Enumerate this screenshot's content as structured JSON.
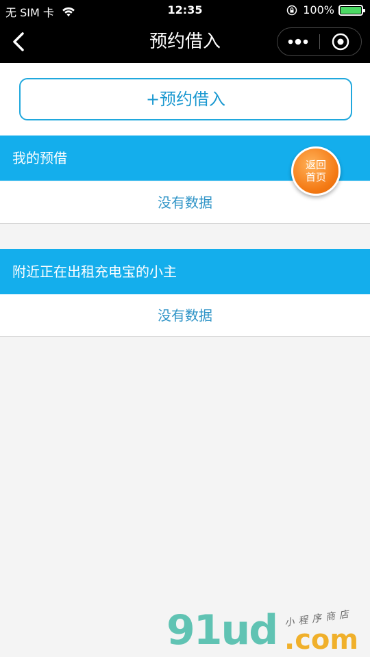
{
  "status_bar": {
    "carrier": "无 SIM 卡",
    "time": "12:35",
    "battery": "100%",
    "battery_level": 1.0
  },
  "nav": {
    "title": "预约借入",
    "icons": [
      "chevron-left-icon",
      "more-dots-icon",
      "target-close-icon"
    ]
  },
  "main": {
    "reserve_button_label": "+预约借入",
    "sections": [
      {
        "header": "我的预借",
        "empty_text": "没有数据"
      },
      {
        "header": "附近正在出租充电宝的小主",
        "empty_text": "没有数据"
      }
    ]
  },
  "home_button": {
    "line1": "返回",
    "line2": "首页"
  },
  "watermark": {
    "logo": "91ud",
    "domain": ".com",
    "subtitle": "小程序商店"
  },
  "colors": {
    "accent": "#14aeec",
    "button_border": "#20a8dd",
    "empty_text": "#2f94c7",
    "home_button": "#f47a14",
    "battery": "#4cd964"
  }
}
